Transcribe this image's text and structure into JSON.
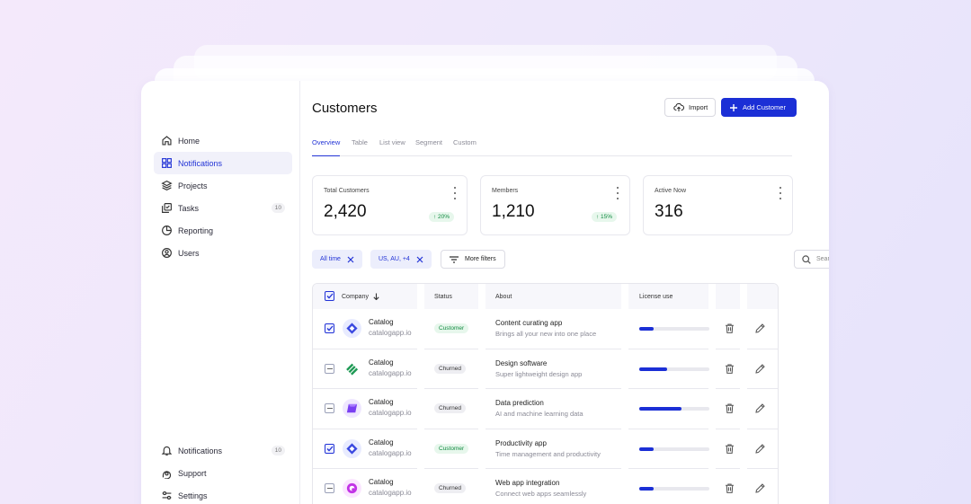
{
  "sidebar": {
    "items": [
      {
        "label": "Home",
        "icon": "home-icon"
      },
      {
        "label": "Notifications",
        "icon": "grid-icon",
        "active": true
      },
      {
        "label": "Projects",
        "icon": "layers-icon"
      },
      {
        "label": "Tasks",
        "icon": "tasks-icon",
        "count": "10"
      },
      {
        "label": "Reporting",
        "icon": "pie-chart-icon"
      },
      {
        "label": "Users",
        "icon": "user-icon"
      }
    ],
    "bottom": [
      {
        "label": "Notifications",
        "icon": "bell-icon",
        "count": "10"
      },
      {
        "label": "Support",
        "icon": "support-icon"
      },
      {
        "label": "Settings",
        "icon": "settings-icon"
      }
    ]
  },
  "header": {
    "title": "Customers",
    "import_label": "Import",
    "add_label": "Add Customer"
  },
  "tabs": [
    "Overview",
    "Table",
    "List view",
    "Segment",
    "Custom"
  ],
  "stats": [
    {
      "label": "Total Customers",
      "value": "2,420",
      "change": "20%"
    },
    {
      "label": "Members",
      "value": "1,210",
      "change": "15%"
    },
    {
      "label": "Active Now",
      "value": "316"
    }
  ],
  "filters": {
    "chips": [
      "All time",
      "US, AU, +4"
    ],
    "more_label": "More filters",
    "search_placeholder": "Search"
  },
  "table": {
    "headers": {
      "company": "Company",
      "status": "Status",
      "about": "About",
      "license": "License use"
    },
    "rows": [
      {
        "name": "Catalog",
        "domain": "catalogapp.io",
        "status": "Customer",
        "title": "Content curating app",
        "desc": "Brings all your new into one place",
        "license": 0.2,
        "checked": true,
        "logo": "blue-diamond-logo"
      },
      {
        "name": "Catalog",
        "domain": "catalogapp.io",
        "status": "Churned",
        "title": "Design software",
        "desc": "Super lightweight design app",
        "license": 0.4,
        "checked": false,
        "logo": "green-stripes-logo"
      },
      {
        "name": "Catalog",
        "domain": "catalogapp.io",
        "status": "Churned",
        "title": "Data prediction",
        "desc": "AI and machine learning data",
        "license": 0.6,
        "checked": false,
        "logo": "purple-cube-logo"
      },
      {
        "name": "Catalog",
        "domain": "catalogapp.io",
        "status": "Customer",
        "title": "Productivity app",
        "desc": "Time management and productivity",
        "license": 0.2,
        "checked": true,
        "logo": "blue-diamond-logo"
      },
      {
        "name": "Catalog",
        "domain": "catalogapp.io",
        "status": "Churned",
        "title": "Web app integration",
        "desc": "Connect web apps seamlessly",
        "license": 0.2,
        "checked": false,
        "logo": "magenta-ring-logo"
      }
    ]
  },
  "colors": {
    "accent": "#1b2fd6",
    "success": "#0f8a3f"
  }
}
